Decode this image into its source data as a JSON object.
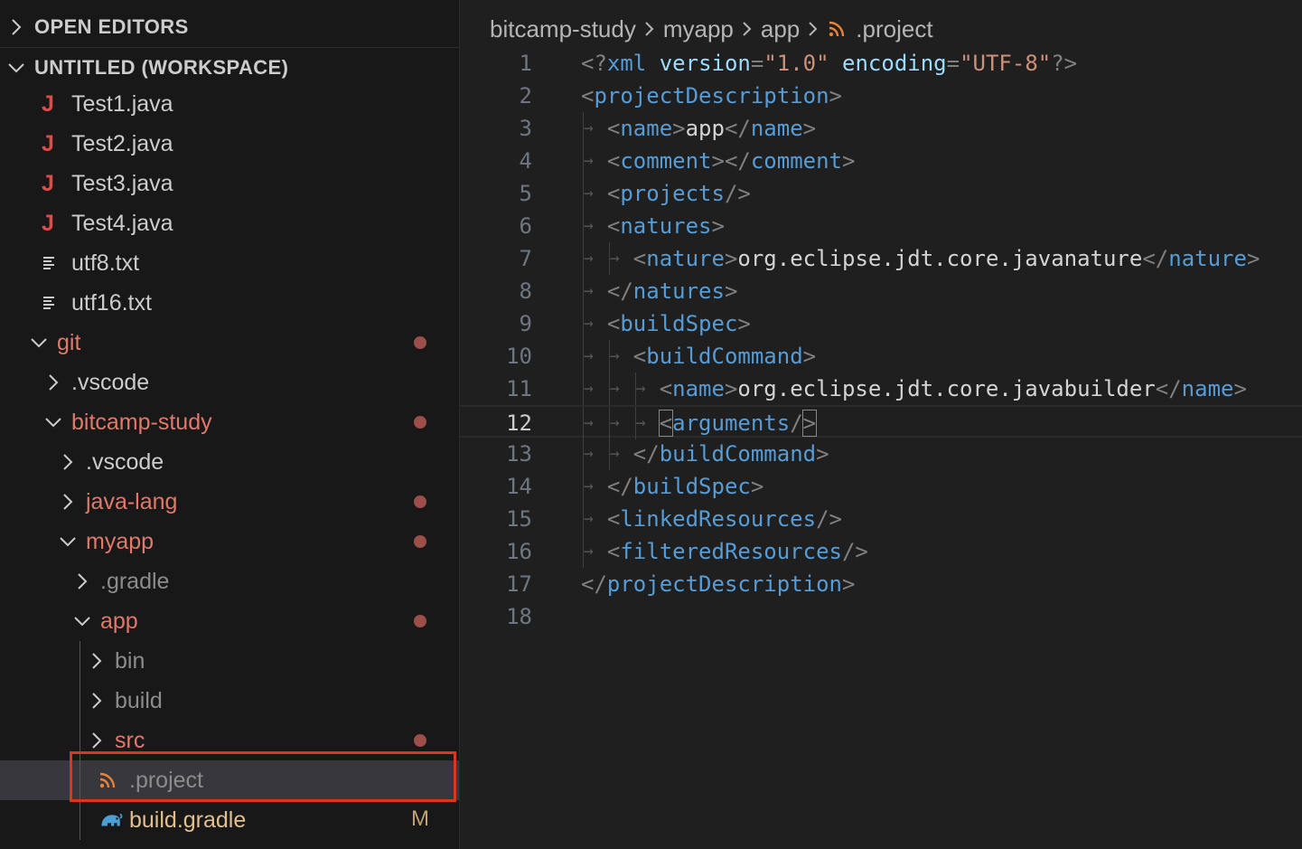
{
  "sidebar": {
    "open_editors_header": "OPEN EDITORS",
    "workspace_header": "UNTITLED (WORKSPACE)",
    "items": [
      {
        "label": "Test1.java",
        "kind": "java-file",
        "label_color": "#cccccc"
      },
      {
        "label": "Test2.java",
        "kind": "java-file",
        "label_color": "#cccccc"
      },
      {
        "label": "Test3.java",
        "kind": "java-file",
        "label_color": "#cccccc"
      },
      {
        "label": "Test4.java",
        "kind": "java-file",
        "label_color": "#cccccc"
      },
      {
        "label": "utf8.txt",
        "kind": "text-file",
        "label_color": "#cccccc"
      },
      {
        "label": "utf16.txt",
        "kind": "text-file",
        "label_color": "#cccccc"
      },
      {
        "label": "git",
        "kind": "folder",
        "expanded": true,
        "modified_dot": true,
        "label_color": "#e2786a"
      },
      {
        "label": ".vscode",
        "kind": "folder",
        "expanded": false,
        "label_color": "#cccccc"
      },
      {
        "label": "bitcamp-study",
        "kind": "folder",
        "expanded": true,
        "modified_dot": true,
        "label_color": "#e2786a"
      },
      {
        "label": ".vscode",
        "kind": "folder",
        "expanded": false,
        "label_color": "#cccccc"
      },
      {
        "label": "java-lang",
        "kind": "folder",
        "expanded": false,
        "modified_dot": true,
        "label_color": "#e2786a"
      },
      {
        "label": "myapp",
        "kind": "folder",
        "expanded": true,
        "modified_dot": true,
        "label_color": "#e2786a"
      },
      {
        "label": ".gradle",
        "kind": "folder",
        "expanded": false,
        "label_color": "#8c8c8c"
      },
      {
        "label": "app",
        "kind": "folder",
        "expanded": true,
        "modified_dot": true,
        "label_color": "#e2786a"
      },
      {
        "label": "bin",
        "kind": "folder",
        "expanded": false,
        "label_color": "#8c8c8c"
      },
      {
        "label": "build",
        "kind": "folder",
        "expanded": false,
        "label_color": "#8c8c8c"
      },
      {
        "label": "src",
        "kind": "folder",
        "expanded": false,
        "modified_dot": true,
        "label_color": "#e2786a"
      },
      {
        "label": ".project",
        "kind": "rss-file",
        "selected": true,
        "label_color": "#8c8c8c"
      },
      {
        "label": "build.gradle",
        "kind": "gradle-file",
        "badge": "M",
        "label_color": "#e2c08d"
      }
    ]
  },
  "breadcrumb": [
    "bitcamp-study",
    "myapp",
    "app",
    ".project"
  ],
  "editor": {
    "current_line": 12,
    "lines": [
      {
        "n": "1",
        "depth": 0,
        "tokens": [
          [
            "b",
            "<?"
          ],
          [
            "tag",
            "xml"
          ],
          [
            "t",
            " "
          ],
          [
            "attr",
            "version"
          ],
          [
            "b",
            "="
          ],
          [
            "str",
            "\"1.0\""
          ],
          [
            "t",
            " "
          ],
          [
            "attr",
            "encoding"
          ],
          [
            "b",
            "="
          ],
          [
            "str",
            "\"UTF-8\""
          ],
          [
            "b",
            "?>"
          ]
        ]
      },
      {
        "n": "2",
        "depth": 0,
        "tokens": [
          [
            "b",
            "<"
          ],
          [
            "tag",
            "projectDescription"
          ],
          [
            "b",
            ">"
          ]
        ]
      },
      {
        "n": "3",
        "depth": 1,
        "tokens": [
          [
            "b",
            "<"
          ],
          [
            "tag",
            "name"
          ],
          [
            "b",
            ">"
          ],
          [
            "t",
            "app"
          ],
          [
            "b",
            "</"
          ],
          [
            "tag",
            "name"
          ],
          [
            "b",
            ">"
          ]
        ]
      },
      {
        "n": "4",
        "depth": 1,
        "tokens": [
          [
            "b",
            "<"
          ],
          [
            "tag",
            "comment"
          ],
          [
            "b",
            "></"
          ],
          [
            "tag",
            "comment"
          ],
          [
            "b",
            ">"
          ]
        ]
      },
      {
        "n": "5",
        "depth": 1,
        "tokens": [
          [
            "b",
            "<"
          ],
          [
            "tag",
            "projects"
          ],
          [
            "b",
            "/>"
          ]
        ]
      },
      {
        "n": "6",
        "depth": 1,
        "tokens": [
          [
            "b",
            "<"
          ],
          [
            "tag",
            "natures"
          ],
          [
            "b",
            ">"
          ]
        ]
      },
      {
        "n": "7",
        "depth": 2,
        "tokens": [
          [
            "b",
            "<"
          ],
          [
            "tag",
            "nature"
          ],
          [
            "b",
            ">"
          ],
          [
            "t",
            "org.eclipse.jdt.core.javanature"
          ],
          [
            "b",
            "</"
          ],
          [
            "tag",
            "nature"
          ],
          [
            "b",
            ">"
          ]
        ]
      },
      {
        "n": "8",
        "depth": 1,
        "tokens": [
          [
            "b",
            "</"
          ],
          [
            "tag",
            "natures"
          ],
          [
            "b",
            ">"
          ]
        ]
      },
      {
        "n": "9",
        "depth": 1,
        "tokens": [
          [
            "b",
            "<"
          ],
          [
            "tag",
            "buildSpec"
          ],
          [
            "b",
            ">"
          ]
        ]
      },
      {
        "n": "10",
        "depth": 2,
        "tokens": [
          [
            "b",
            "<"
          ],
          [
            "tag",
            "buildCommand"
          ],
          [
            "b",
            ">"
          ]
        ]
      },
      {
        "n": "11",
        "depth": 3,
        "tokens": [
          [
            "b",
            "<"
          ],
          [
            "tag",
            "name"
          ],
          [
            "b",
            ">"
          ],
          [
            "t",
            "org.eclipse.jdt.core.javabuilder"
          ],
          [
            "b",
            "</"
          ],
          [
            "tag",
            "name"
          ],
          [
            "b",
            ">"
          ]
        ]
      },
      {
        "n": "12",
        "depth": 3,
        "tokens": [
          [
            "bb",
            "<"
          ],
          [
            "tag",
            "arguments"
          ],
          [
            "b",
            "/"
          ],
          [
            "bb",
            ">"
          ]
        ]
      },
      {
        "n": "13",
        "depth": 2,
        "tokens": [
          [
            "b",
            "</"
          ],
          [
            "tag",
            "buildCommand"
          ],
          [
            "b",
            ">"
          ]
        ]
      },
      {
        "n": "14",
        "depth": 1,
        "tokens": [
          [
            "b",
            "</"
          ],
          [
            "tag",
            "buildSpec"
          ],
          [
            "b",
            ">"
          ]
        ]
      },
      {
        "n": "15",
        "depth": 1,
        "tokens": [
          [
            "b",
            "<"
          ],
          [
            "tag",
            "linkedResources"
          ],
          [
            "b",
            "/>"
          ]
        ]
      },
      {
        "n": "16",
        "depth": 1,
        "tokens": [
          [
            "b",
            "<"
          ],
          [
            "tag",
            "filteredResources"
          ],
          [
            "b",
            "/>"
          ]
        ]
      },
      {
        "n": "17",
        "depth": 0,
        "tokens": [
          [
            "b",
            "</"
          ],
          [
            "tag",
            "projectDescription"
          ],
          [
            "b",
            ">"
          ]
        ]
      },
      {
        "n": "18",
        "depth": 0,
        "tokens": []
      }
    ]
  },
  "colors": {
    "modified_dot": "#9c4f48",
    "highlight_box": "#d9381e",
    "java_icon": "#e04a4a",
    "rss_icon": "#e8833a",
    "gradle_icon": "#4a9fd4"
  }
}
